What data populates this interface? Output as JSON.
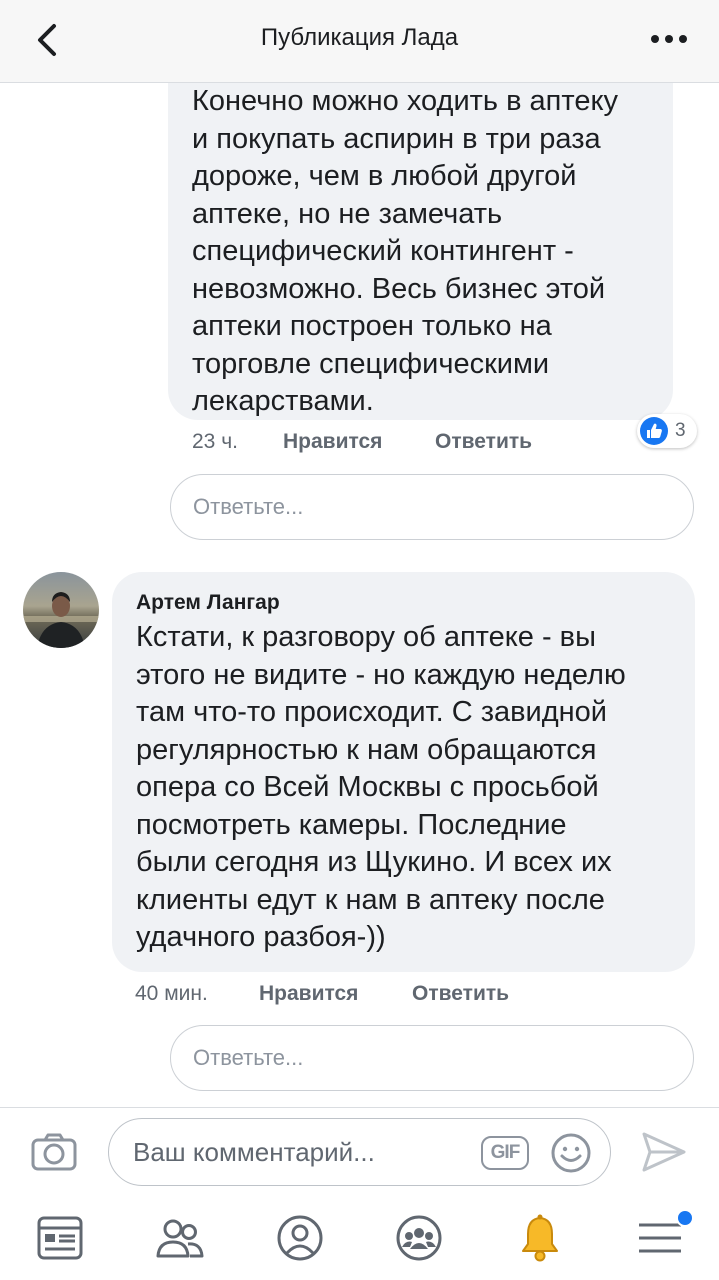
{
  "header": {
    "title": "Публикация Лада",
    "back_icon": "chevron-left-icon",
    "more_icon": "more-horizontal-icon"
  },
  "comments": [
    {
      "lines": [
        "Конечно можно ходить в аптеку",
        "и покупать аспирин в три раза",
        "дороже, чем  в любой другой",
        "аптеке, но не замечать",
        "специфический контингент -",
        "невозможно. Весь бизнес этой",
        "аптеки построен только на",
        "торговле специфическими",
        "лекарствами."
      ],
      "time": "23 ч.",
      "like_label": "Нравится",
      "reply_label": "Ответить",
      "reaction_count": "3",
      "reaction_icon": "like-reaction-icon",
      "reply_placeholder": "Ответьте..."
    },
    {
      "author": "Артем Лангар",
      "lines": [
        "Кстати, к разговору об аптеке - вы",
        "этого не видите - но каждую неделю",
        "там что-то происходит. С завидной",
        "регулярностью к нам обращаются",
        "опера со Всей Москвы с просьбой",
        "посмотреть камеры. Последние",
        "были сегодня из Щукино. И всех их",
        "клиенты едут к нам в аптеку после",
        "удачного разбоя-))"
      ],
      "time": "40 мин.",
      "like_label": "Нравится",
      "reply_label": "Ответить",
      "reply_placeholder": "Ответьте..."
    }
  ],
  "composer": {
    "placeholder": "Ваш комментарий...",
    "gif_label": "GIF",
    "camera_icon": "camera-icon",
    "emoji_icon": "emoji-icon",
    "send_icon": "send-icon"
  },
  "tabbar": {
    "items": [
      "news-feed-icon",
      "friends-icon",
      "profile-icon",
      "groups-icon",
      "notifications-bell-icon",
      "menu-icon"
    ],
    "menu_has_badge": true
  },
  "colors": {
    "accent": "#1877f2",
    "bubble": "#f0f2f5",
    "bell": "#f7b928"
  }
}
